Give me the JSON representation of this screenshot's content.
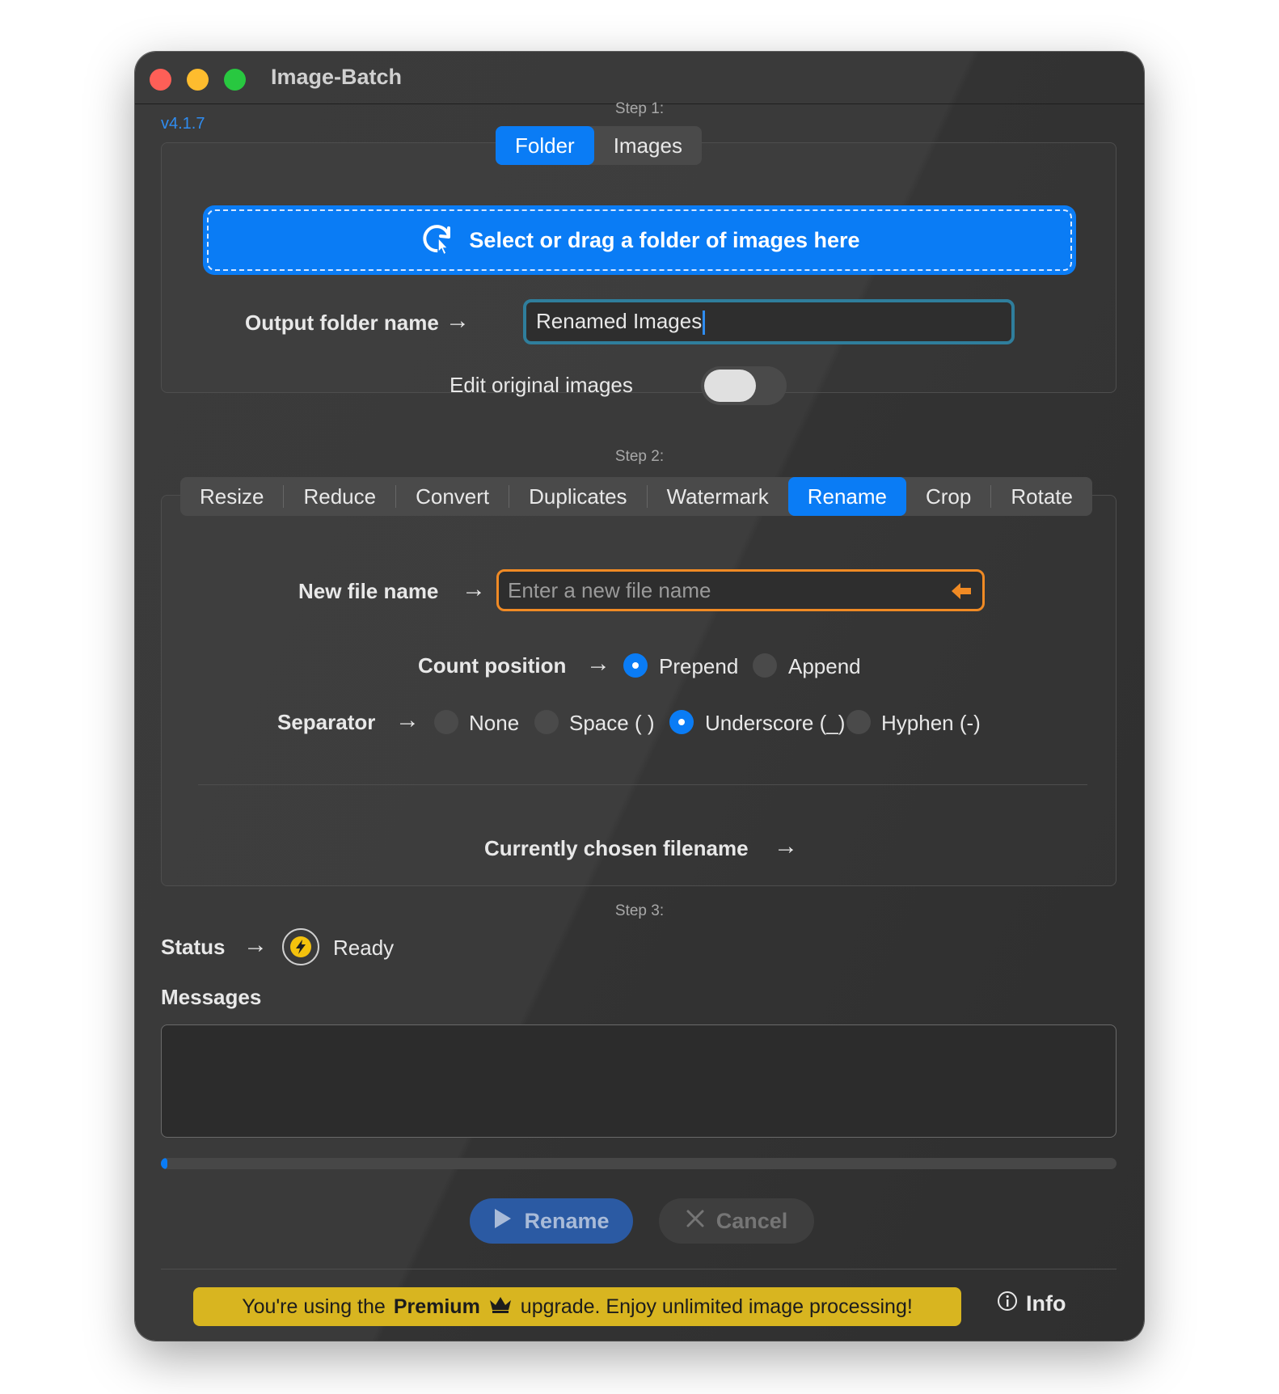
{
  "window": {
    "title": "Image-Batch",
    "version": "v4.1.7"
  },
  "step1": {
    "label": "Step 1:",
    "tabs": [
      {
        "label": "Folder",
        "active": true
      },
      {
        "label": "Images",
        "active": false
      }
    ],
    "dropzone_label": "Select or drag a folder of images here",
    "output_folder_label": "Output folder name",
    "output_folder_value": "Renamed Images",
    "edit_original_label": "Edit original images",
    "edit_original_on": false
  },
  "step2": {
    "label": "Step 2:",
    "tabs": [
      "Resize",
      "Reduce",
      "Convert",
      "Duplicates",
      "Watermark",
      "Rename",
      "Crop",
      "Rotate"
    ],
    "active_tab": "Rename",
    "new_file_name_label": "New file name",
    "new_file_name_placeholder": "Enter a new file name",
    "new_file_name_value": "",
    "count_position_label": "Count position",
    "count_position_options": [
      "Prepend",
      "Append"
    ],
    "count_position_selected": "Prepend",
    "separator_label": "Separator",
    "separator_options": [
      "None",
      "Space ( )",
      "Underscore (_)",
      "Hyphen (-)"
    ],
    "separator_selected": "Underscore (_)",
    "chosen_filename_label": "Currently chosen filename"
  },
  "step3": {
    "label": "Step 3:",
    "status_label": "Status",
    "status_value": "Ready",
    "messages_label": "Messages",
    "messages_text": "",
    "progress_percent": 0.5,
    "rename_button": "Rename",
    "cancel_button": "Cancel"
  },
  "footer": {
    "premium_pre": "You're using the",
    "premium_bold": "Premium",
    "premium_post": "upgrade. Enjoy unlimited image processing!",
    "info_label": "Info"
  },
  "colors": {
    "accent": "#0a7cf5",
    "premium": "#d8b520",
    "focus_orange": "#f08a24",
    "focus_teal": "#2f7e9c"
  },
  "icons": [
    "pointer-refresh-icon",
    "arrow-right-icon",
    "orange-arrow-left-icon",
    "lightning-icon",
    "play-icon",
    "close-x-icon",
    "crown-icon",
    "info-icon"
  ]
}
